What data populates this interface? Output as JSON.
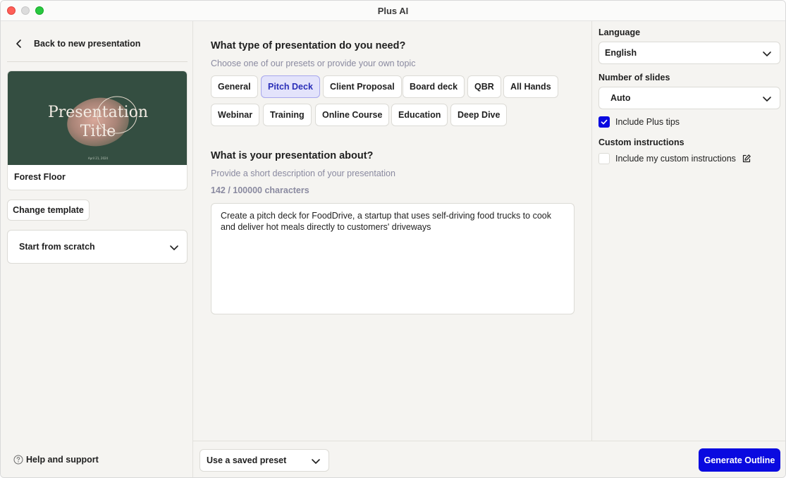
{
  "window": {
    "title": "Plus AI"
  },
  "sidebar": {
    "back_label": "Back to new presentation",
    "template": {
      "preview_title_line1": "Presentation",
      "preview_title_line2": "Title",
      "preview_date": "April 21, 2024",
      "name": "Forest Floor"
    },
    "change_template_label": "Change template",
    "start_option": "Start from scratch",
    "help_label": "Help and support"
  },
  "main": {
    "type_heading": "What type of presentation do you need?",
    "type_subheading": "Choose one of our presets or provide your own topic",
    "presets": [
      {
        "label": "General",
        "selected": false
      },
      {
        "label": "Pitch Deck",
        "selected": true
      },
      {
        "label": "Client Proposal",
        "selected": false
      },
      {
        "label": "Board deck",
        "selected": false
      },
      {
        "label": "QBR",
        "selected": false
      },
      {
        "label": "All Hands",
        "selected": false
      },
      {
        "label": "Webinar",
        "selected": false
      },
      {
        "label": "Training",
        "selected": false
      },
      {
        "label": "Online Course",
        "selected": false
      },
      {
        "label": "Education",
        "selected": false
      },
      {
        "label": "Deep Dive",
        "selected": false
      }
    ],
    "about_heading": "What is your presentation about?",
    "about_subheading": "Provide a short description of your presentation",
    "char_count": "142 / 100000 characters",
    "description": "Create a pitch deck for FoodDrive, a startup that uses self-driving food trucks to cook and deliver hot meals directly to customers' driveways"
  },
  "settings": {
    "language_label": "Language",
    "language_value": "English",
    "slides_label": "Number of slides",
    "slides_value": "Auto",
    "include_tips_label": "Include Plus tips",
    "include_tips_checked": true,
    "custom_heading": "Custom instructions",
    "custom_label": "Include my custom instructions",
    "custom_checked": false
  },
  "footer": {
    "preset_label": "Use a saved preset",
    "generate_label": "Generate Outline"
  },
  "colors": {
    "accent": "#0a0ae0",
    "template_bg": "#344e41"
  }
}
